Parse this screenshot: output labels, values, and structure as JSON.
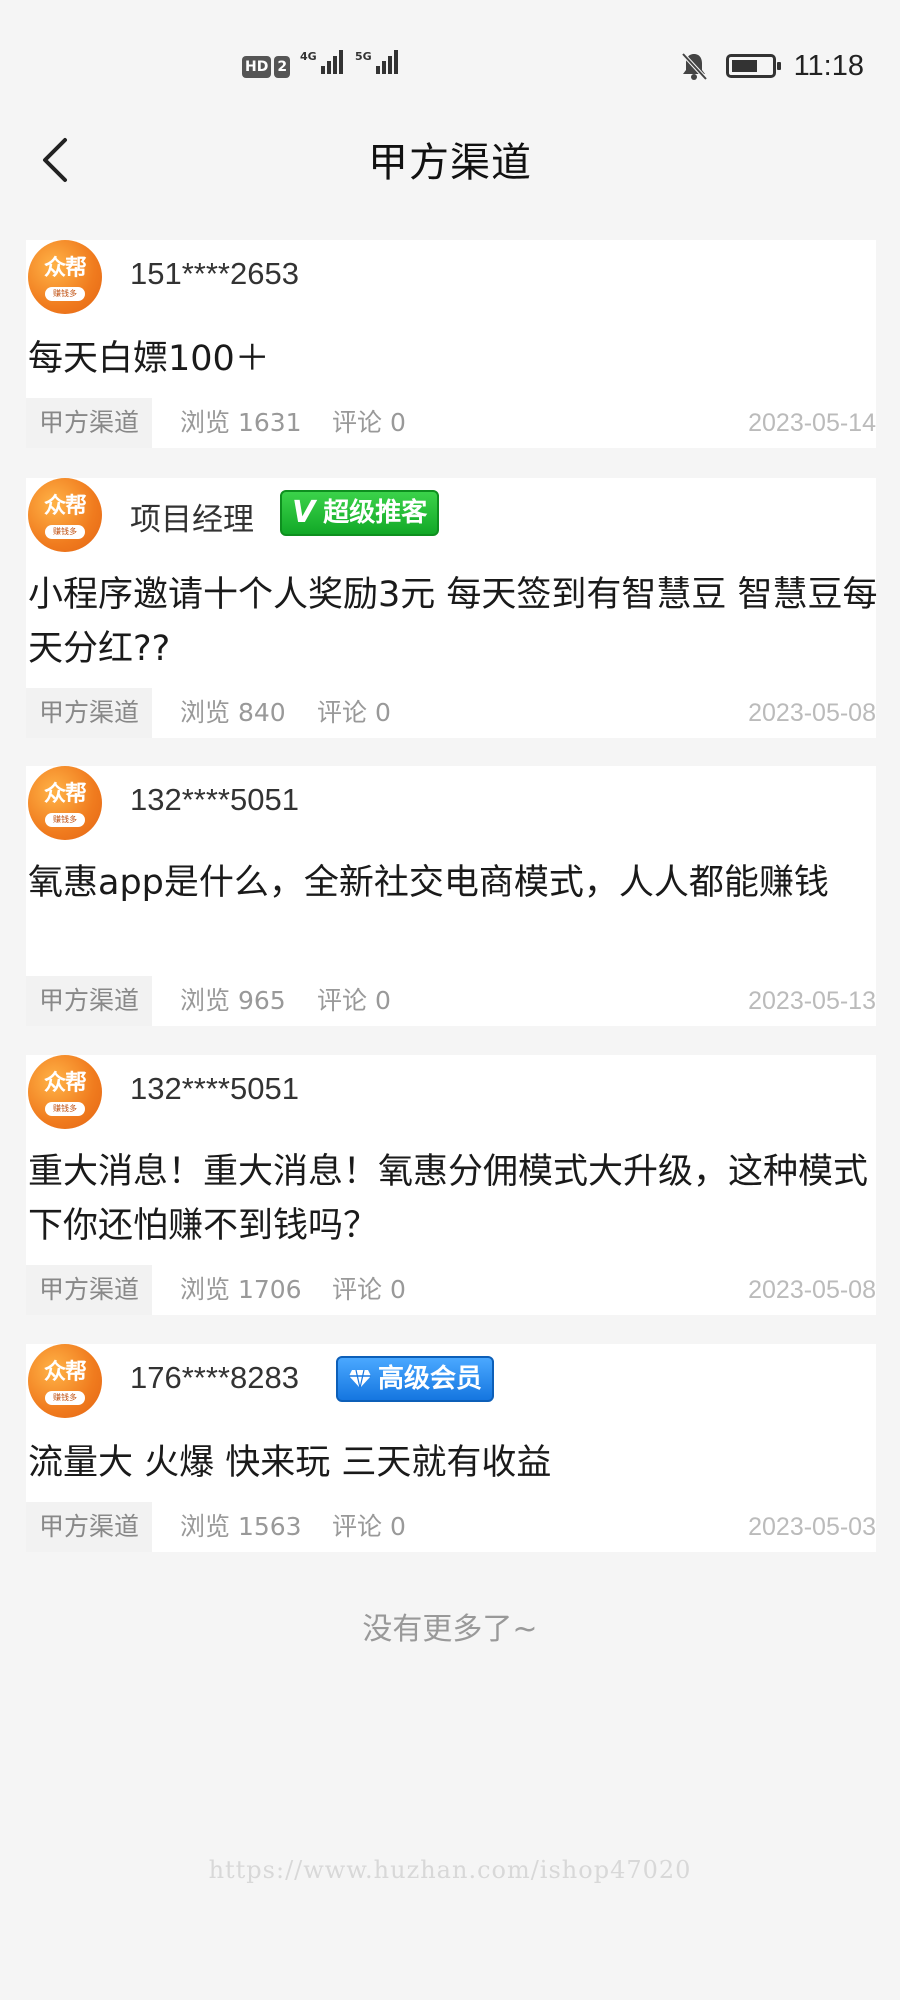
{
  "status_bar": {
    "hd_label": "HD",
    "sim_label": "2",
    "net1": "4G",
    "net2": "5G",
    "time": "11:18"
  },
  "nav": {
    "title": "甲方渠道",
    "back_icon": "chevron-left-icon"
  },
  "avatar": {
    "text": "众帮",
    "sub": "赚钱多"
  },
  "posts": [
    {
      "username": "151****2653",
      "badge": null,
      "title": "每天白嫖100＋",
      "channel": "甲方渠道",
      "views": "浏览 1631",
      "comments": "评论 0",
      "date": "2023-05-14"
    },
    {
      "username": "项目经理",
      "badge": {
        "type": "green",
        "prefix": "V",
        "label": "超级推客"
      },
      "title": "小程序邀请十个人奖励3元 每天签到有智慧豆 智慧豆每天分红??",
      "channel": "甲方渠道",
      "views": "浏览 840",
      "comments": "评论 0",
      "date": "2023-05-08"
    },
    {
      "username": "132****5051",
      "badge": null,
      "title": "氧惠app是什么，全新社交电商模式，人人都能赚钱",
      "channel": "甲方渠道",
      "views": "浏览 965",
      "comments": "评论 0",
      "date": "2023-05-13"
    },
    {
      "username": "132****5051",
      "badge": null,
      "title": "重大消息！重大消息！氧惠分佣模式大升级，这种模式下你还怕赚不到钱吗？",
      "channel": "甲方渠道",
      "views": "浏览 1706",
      "comments": "评论 0",
      "date": "2023-05-08"
    },
    {
      "username": "176****8283",
      "badge": {
        "type": "blue",
        "icon": "diamond-icon",
        "label": "高级会员"
      },
      "title": "流量大 火爆 快来玩 三天就有收益",
      "channel": "甲方渠道",
      "views": "浏览 1563",
      "comments": "评论 0",
      "date": "2023-05-03"
    }
  ],
  "footer": {
    "no_more": "没有更多了~",
    "watermark": "https://www.huzhan.com/ishop47020"
  },
  "colors": {
    "background": "#f5f5f5",
    "card": "#ffffff",
    "avatar_orange": "#f07b1e",
    "badge_green": "#12a827",
    "badge_blue": "#1576e0",
    "meta_text": "#999999"
  }
}
